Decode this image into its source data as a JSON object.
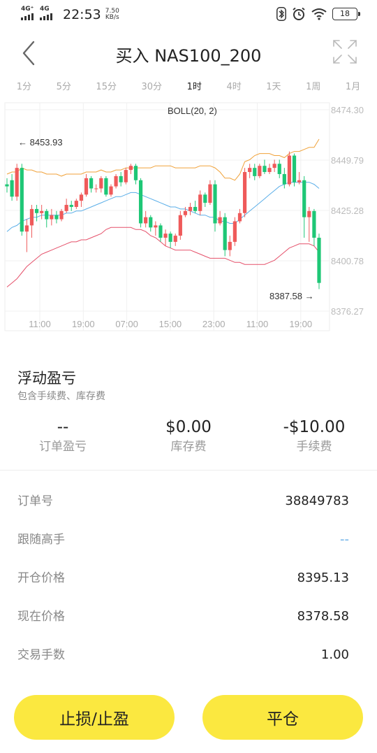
{
  "status_bar": {
    "sig1": "4G⁺",
    "sig2": "4G",
    "time": "22:53",
    "speed_value": "7.50",
    "speed_unit": "KB/s",
    "battery": "18"
  },
  "header": {
    "title": "买入 NAS100_200"
  },
  "timeframes": [
    "1分",
    "5分",
    "15分",
    "30分",
    "1时",
    "4时",
    "1天",
    "1周",
    "1月"
  ],
  "active_timeframe": "1时",
  "chart_data": {
    "type": "candlestick",
    "indicator": "BOLL(20, 2)",
    "y_ticks": [
      "8474.30",
      "8449.79",
      "8425.28",
      "8400.78",
      "8376.27"
    ],
    "x_ticks": [
      "11:00",
      "19:00",
      "07:00",
      "15:00",
      "23:00",
      "11:00",
      "19:00"
    ],
    "ylim": [
      8376.27,
      8474.3
    ],
    "high_label": "← 8453.93",
    "low_label": "8387.58 →",
    "colors": {
      "up": "#ef5a5a",
      "down": "#1ec776",
      "upper": "#f0a23a",
      "middle": "#5aaee8",
      "lower": "#e5506a"
    },
    "candles": [
      [
        8438,
        8437,
        8441,
        8434
      ],
      [
        8440,
        8432,
        8443,
        8430
      ],
      [
        8432,
        8446,
        8448,
        8430
      ],
      [
        8446,
        8415,
        8448,
        8413
      ],
      [
        8415,
        8418,
        8421,
        8405
      ],
      [
        8418,
        8426,
        8428,
        8412
      ],
      [
        8426,
        8424,
        8428,
        8420
      ],
      [
        8424,
        8425,
        8428,
        8421
      ],
      [
        8425,
        8421,
        8426,
        8417
      ],
      [
        8421,
        8423,
        8426,
        8418
      ],
      [
        8423,
        8421,
        8425,
        8419
      ],
      [
        8421,
        8425,
        8426,
        8420
      ],
      [
        8425,
        8428,
        8431,
        8424
      ],
      [
        8428,
        8427,
        8430,
        8425
      ],
      [
        8427,
        8430,
        8431,
        8426
      ],
      [
        8430,
        8433,
        8434,
        8427
      ],
      [
        8433,
        8441,
        8443,
        8432
      ],
      [
        8441,
        8436,
        8442,
        8434
      ],
      [
        8436,
        8436,
        8438,
        8434
      ],
      [
        8436,
        8441,
        8442,
        8434
      ],
      [
        8441,
        8433,
        8442,
        8432
      ],
      [
        8433,
        8437,
        8438,
        8432
      ],
      [
        8437,
        8442,
        8443,
        8436
      ],
      [
        8442,
        8439,
        8444,
        8437
      ],
      [
        8439,
        8445,
        8446,
        8438
      ],
      [
        8445,
        8447,
        8448,
        8443
      ],
      [
        8447,
        8440,
        8448,
        8438
      ],
      [
        8440,
        8419,
        8441,
        8417
      ],
      [
        8419,
        8422,
        8425,
        8417
      ],
      [
        8422,
        8417,
        8423,
        8415
      ],
      [
        8417,
        8418,
        8420,
        8413
      ],
      [
        8418,
        8412,
        8419,
        8410
      ],
      [
        8412,
        8414,
        8416,
        8408
      ],
      [
        8414,
        8410,
        8415,
        8407
      ],
      [
        8410,
        8413,
        8414,
        8408
      ],
      [
        8413,
        8423,
        8425,
        8411
      ],
      [
        8423,
        8425,
        8427,
        8422
      ],
      [
        8425,
        8427,
        8429,
        8423
      ],
      [
        8427,
        8425,
        8430,
        8424
      ],
      [
        8425,
        8433,
        8435,
        8423
      ],
      [
        8433,
        8429,
        8434,
        8427
      ],
      [
        8429,
        8438,
        8440,
        8428
      ],
      [
        8438,
        8419,
        8440,
        8415
      ],
      [
        8419,
        8422,
        8425,
        8418
      ],
      [
        8422,
        8406,
        8424,
        8403
      ],
      [
        8406,
        8410,
        8413,
        8403
      ],
      [
        8410,
        8420,
        8422,
        8408
      ],
      [
        8420,
        8424,
        8426,
        8419
      ],
      [
        8424,
        8444,
        8446,
        8422
      ],
      [
        8444,
        8446,
        8448,
        8441
      ],
      [
        8446,
        8442,
        8448,
        8440
      ],
      [
        8442,
        8447,
        8448,
        8441
      ],
      [
        8447,
        8444,
        8450,
        8443
      ],
      [
        8444,
        8446,
        8448,
        8443
      ],
      [
        8446,
        8448,
        8450,
        8444
      ],
      [
        8448,
        8443,
        8450,
        8441
      ],
      [
        8443,
        8438,
        8446,
        8436
      ],
      [
        8438,
        8452,
        8454,
        8437
      ],
      [
        8452,
        8439,
        8453,
        8437
      ],
      [
        8439,
        8440,
        8444,
        8438
      ],
      [
        8440,
        8422,
        8442,
        8412
      ],
      [
        8422,
        8425,
        8427,
        8410
      ],
      [
        8425,
        8412,
        8426,
        8408
      ],
      [
        8412,
        8390,
        8414,
        8387
      ]
    ],
    "boll_upper": [
      8443,
      8444,
      8444,
      8446,
      8445,
      8445,
      8444,
      8444,
      8443,
      8443,
      8443,
      8442,
      8443,
      8443,
      8443,
      8443,
      8444,
      8444,
      8444,
      8445,
      8444,
      8444,
      8445,
      8445,
      8446,
      8446,
      8446,
      8446,
      8446,
      8446,
      8447,
      8447,
      8447,
      8447,
      8446,
      8446,
      8446,
      8446,
      8446,
      8447,
      8447,
      8447,
      8446,
      8444,
      8441,
      8441,
      8440,
      8443,
      8449,
      8450,
      8452,
      8453,
      8453,
      8453,
      8452,
      8452,
      8451,
      8453,
      8454,
      8454,
      8455,
      8456,
      8456,
      8460
    ],
    "boll_middle": [
      8415,
      8417,
      8418,
      8420,
      8421,
      8422,
      8422,
      8423,
      8423,
      8423,
      8423,
      8423,
      8424,
      8424,
      8425,
      8425,
      8426,
      8427,
      8428,
      8429,
      8430,
      8431,
      8432,
      8432,
      8433,
      8434,
      8434,
      8433,
      8432,
      8431,
      8430,
      8429,
      8428,
      8427,
      8427,
      8426,
      8426,
      8425,
      8424,
      8423,
      8423,
      8422,
      8422,
      8420,
      8420,
      8419,
      8419,
      8421,
      8423,
      8425,
      8427,
      8429,
      8431,
      8433,
      8435,
      8437,
      8438,
      8439,
      8439,
      8439,
      8439,
      8439,
      8438,
      8436
    ],
    "boll_lower": [
      8388,
      8390,
      8392,
      8395,
      8398,
      8400,
      8402,
      8404,
      8405,
      8406,
      8407,
      8408,
      8409,
      8410,
      8410,
      8411,
      8411,
      8412,
      8413,
      8414,
      8416,
      8417,
      8417,
      8417,
      8417,
      8417,
      8416,
      8416,
      8415,
      8413,
      8412,
      8410,
      8408,
      8407,
      8406,
      8406,
      8406,
      8406,
      8405,
      8404,
      8403,
      8402,
      8402,
      8402,
      8402,
      8401,
      8400,
      8400,
      8399,
      8399,
      8399,
      8399,
      8399,
      8400,
      8401,
      8403,
      8405,
      8407,
      8408,
      8409,
      8409,
      8409,
      8408,
      8405
    ]
  },
  "pnl": {
    "title": "浮动盈亏",
    "subtitle": "包含手续费、库存费",
    "stats": [
      {
        "value": "--",
        "label": "订单盈亏"
      },
      {
        "value": "$0.00",
        "label": "库存费"
      },
      {
        "value": "-$10.00",
        "label": "手续费"
      }
    ]
  },
  "details": [
    {
      "key": "订单号",
      "value": "38849783"
    },
    {
      "key": "跟随高手",
      "value": "--"
    },
    {
      "key": "开仓价格",
      "value": "8395.13"
    },
    {
      "key": "现在价格",
      "value": "8378.58"
    },
    {
      "key": "交易手数",
      "value": "1.00"
    }
  ],
  "buttons": {
    "stop": "止损/止盈",
    "close": "平仓"
  }
}
